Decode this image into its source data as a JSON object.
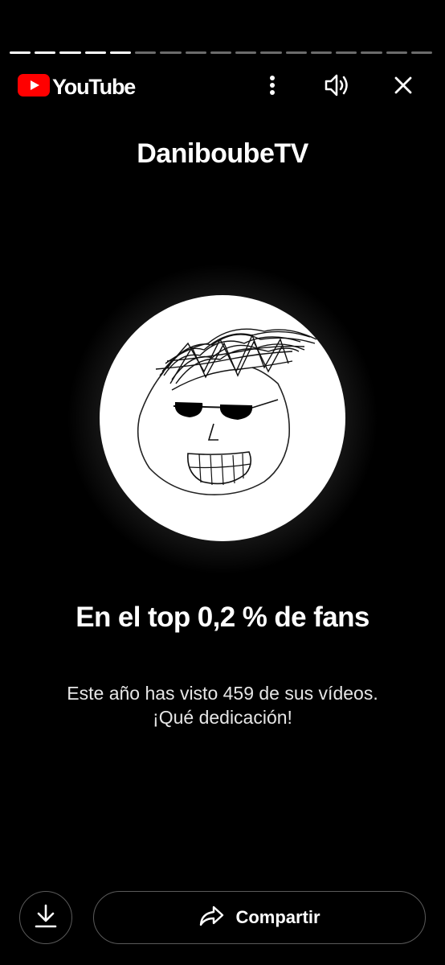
{
  "story": {
    "segments_total": 17,
    "segments_done": 5
  },
  "header": {
    "brand": "YouTube",
    "icons": {
      "logo": "youtube-play-icon",
      "more": "more-vertical-icon",
      "sound": "volume-icon",
      "close": "close-icon"
    }
  },
  "card": {
    "channel": "DaniboubeTV",
    "avatar": "channel-avatar-drawing",
    "headline": "En el top 0,2 % de fans",
    "subtext_line1": "Este año has visto 459 de sus vídeos.",
    "subtext_line2": "¡Qué dedicación!"
  },
  "footer": {
    "download_icon": "download-icon",
    "share_icon": "share-icon",
    "share_label": "Compartir"
  },
  "colors": {
    "background": "#000000",
    "youtube_red": "#FF0000",
    "text": "#FFFFFF",
    "button_border": "#5A5A5A"
  }
}
